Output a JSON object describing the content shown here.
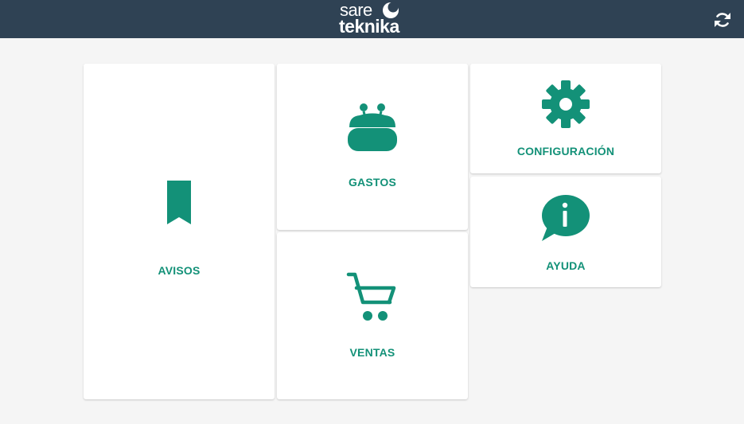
{
  "header": {
    "logo_line1": "sare",
    "logo_line2": "teknika",
    "refresh_icon": "refresh-icon",
    "background_color": "#2f4254"
  },
  "theme": {
    "accent": "#139178",
    "card_background": "#ffffff",
    "page_background": "#f5f5f5"
  },
  "tiles": {
    "avisos": {
      "label": "AVISOS",
      "icon": "bookmark-icon"
    },
    "gastos": {
      "label": "GASTOS",
      "icon": "purse-icon"
    },
    "ventas": {
      "label": "VENTAS",
      "icon": "shopping-cart-icon"
    },
    "configuracion": {
      "label": "CONFIGURACIÓN",
      "icon": "gear-icon"
    },
    "ayuda": {
      "label": "AYUDA",
      "icon": "info-chat-icon"
    }
  }
}
